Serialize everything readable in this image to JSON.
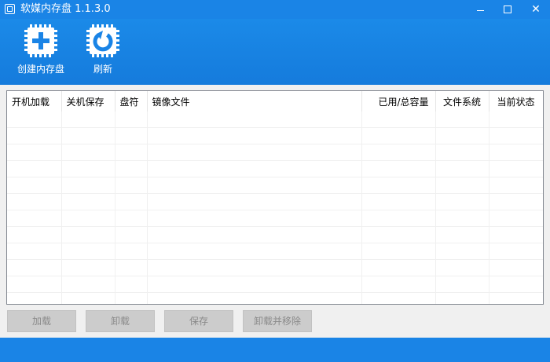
{
  "window": {
    "title": "软媒内存盘 1.1.3.0",
    "accent": "#1a84e6",
    "minimize_icon": "minimize-icon",
    "maximize_icon": "maximize-icon",
    "close_icon": "close-icon",
    "close_glyph": "✕"
  },
  "toolbar": {
    "create": {
      "label": "创建内存盘",
      "icon": "plus-chip-icon"
    },
    "refresh": {
      "label": "刷新",
      "icon": "refresh-chip-icon"
    }
  },
  "table": {
    "columns": [
      "开机加载",
      "关机保存",
      "盘符",
      "镜像文件",
      "已用/总容量",
      "文件系统",
      "当前状态"
    ],
    "rows": []
  },
  "buttons": {
    "load": "加载",
    "unload": "卸载",
    "save": "保存",
    "unload_remove": "卸载并移除"
  }
}
